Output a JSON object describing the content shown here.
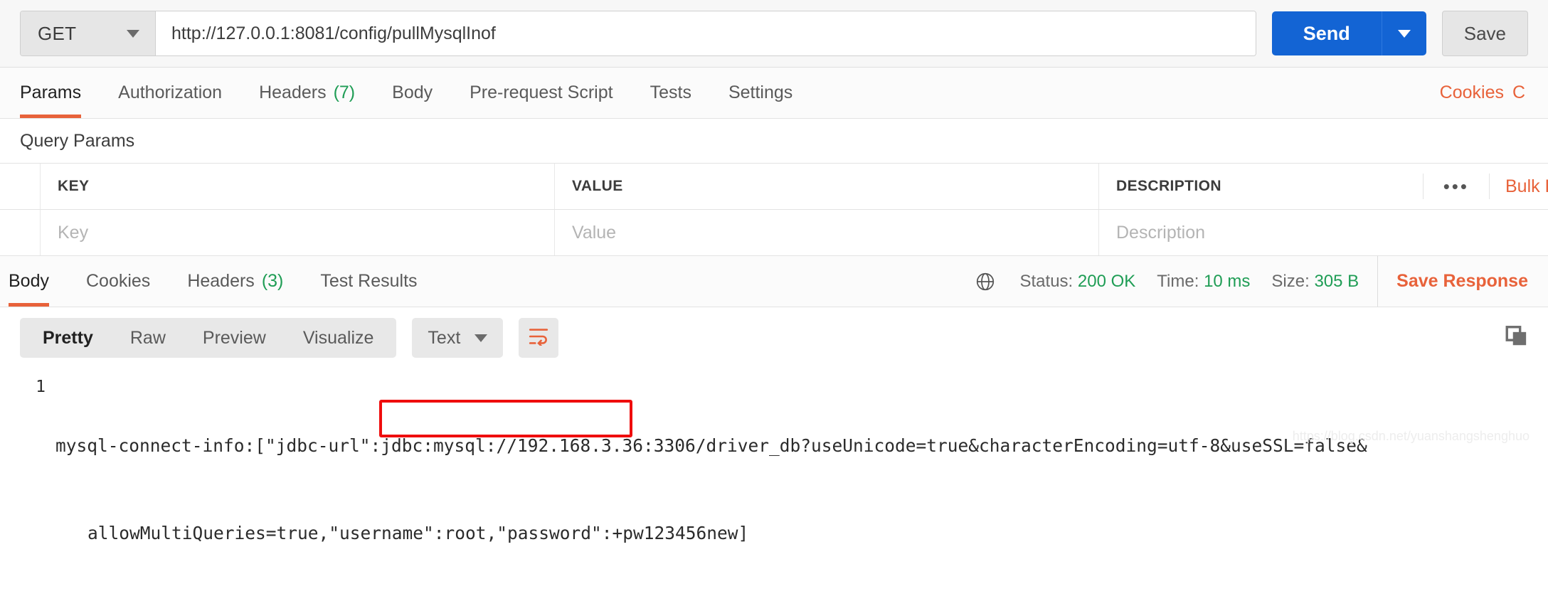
{
  "request": {
    "method": "GET",
    "url": "http://127.0.0.1:8081/config/pullMysqlInof",
    "send_label": "Send",
    "save_label": "Save",
    "method_caret_icon": "chevron-down-icon",
    "send_caret_icon": "chevron-down-icon"
  },
  "request_tabs": [
    {
      "label": "Params",
      "count": "",
      "active": true
    },
    {
      "label": "Authorization",
      "count": "",
      "active": false
    },
    {
      "label": "Headers",
      "count": "(7)",
      "active": false
    },
    {
      "label": "Body",
      "count": "",
      "active": false
    },
    {
      "label": "Pre-request Script",
      "count": "",
      "active": false
    },
    {
      "label": "Tests",
      "count": "",
      "active": false
    },
    {
      "label": "Settings",
      "count": "",
      "active": false
    }
  ],
  "request_tabs_right": {
    "cookies_label": "Cookies",
    "cut_off_label": "C"
  },
  "query_params": {
    "section_title": "Query Params",
    "columns": [
      "KEY",
      "VALUE",
      "DESCRIPTION"
    ],
    "placeholder_row": {
      "key": "Key",
      "value": "Value",
      "description": "Description"
    },
    "more_icon": "•••",
    "bulk_label": "Bulk Edit"
  },
  "response_tabs": [
    {
      "label": "Body",
      "count": "",
      "active": true
    },
    {
      "label": "Cookies",
      "count": "",
      "active": false
    },
    {
      "label": "Headers",
      "count": "(3)",
      "active": false
    },
    {
      "label": "Test Results",
      "count": "",
      "active": false
    }
  ],
  "response_meta": {
    "status_label": "Status:",
    "status_value": "200 OK",
    "time_label": "Time:",
    "time_value": "10 ms",
    "size_label": "Size:",
    "size_value": "305 B",
    "save_response_label": "Save Response",
    "globe_icon": "globe-icon"
  },
  "body_toolbar": {
    "views": [
      "Pretty",
      "Raw",
      "Preview",
      "Visualize"
    ],
    "active_view": "Pretty",
    "format": "Text",
    "format_caret_icon": "chevron-down-icon",
    "wrap_icon": "word-wrap-icon",
    "copy_icon": "copy-icon"
  },
  "response_body": {
    "line_number": "1",
    "line1": "mysql-connect-info:[\"jdbc-url\":jdbc:mysql://192.168.3.36:3306/driver_db?useUnicode=true&characterEncoding=utf-8&useSSL=false&",
    "line2": "allowMultiQueries=true,\"username\":root,\"password\":+pw123456new]"
  },
  "annotation": {
    "highlight_color": "#ef0d0d",
    "highlighted_text": "\"password\":+pw123456new]"
  },
  "watermark": {
    "text": "https://blog.csdn.net/yuanshangshenghuo"
  },
  "colors": {
    "accent_orange": "#e8623a",
    "primary_blue": "#1364d4",
    "success_green": "#1f9d55"
  }
}
